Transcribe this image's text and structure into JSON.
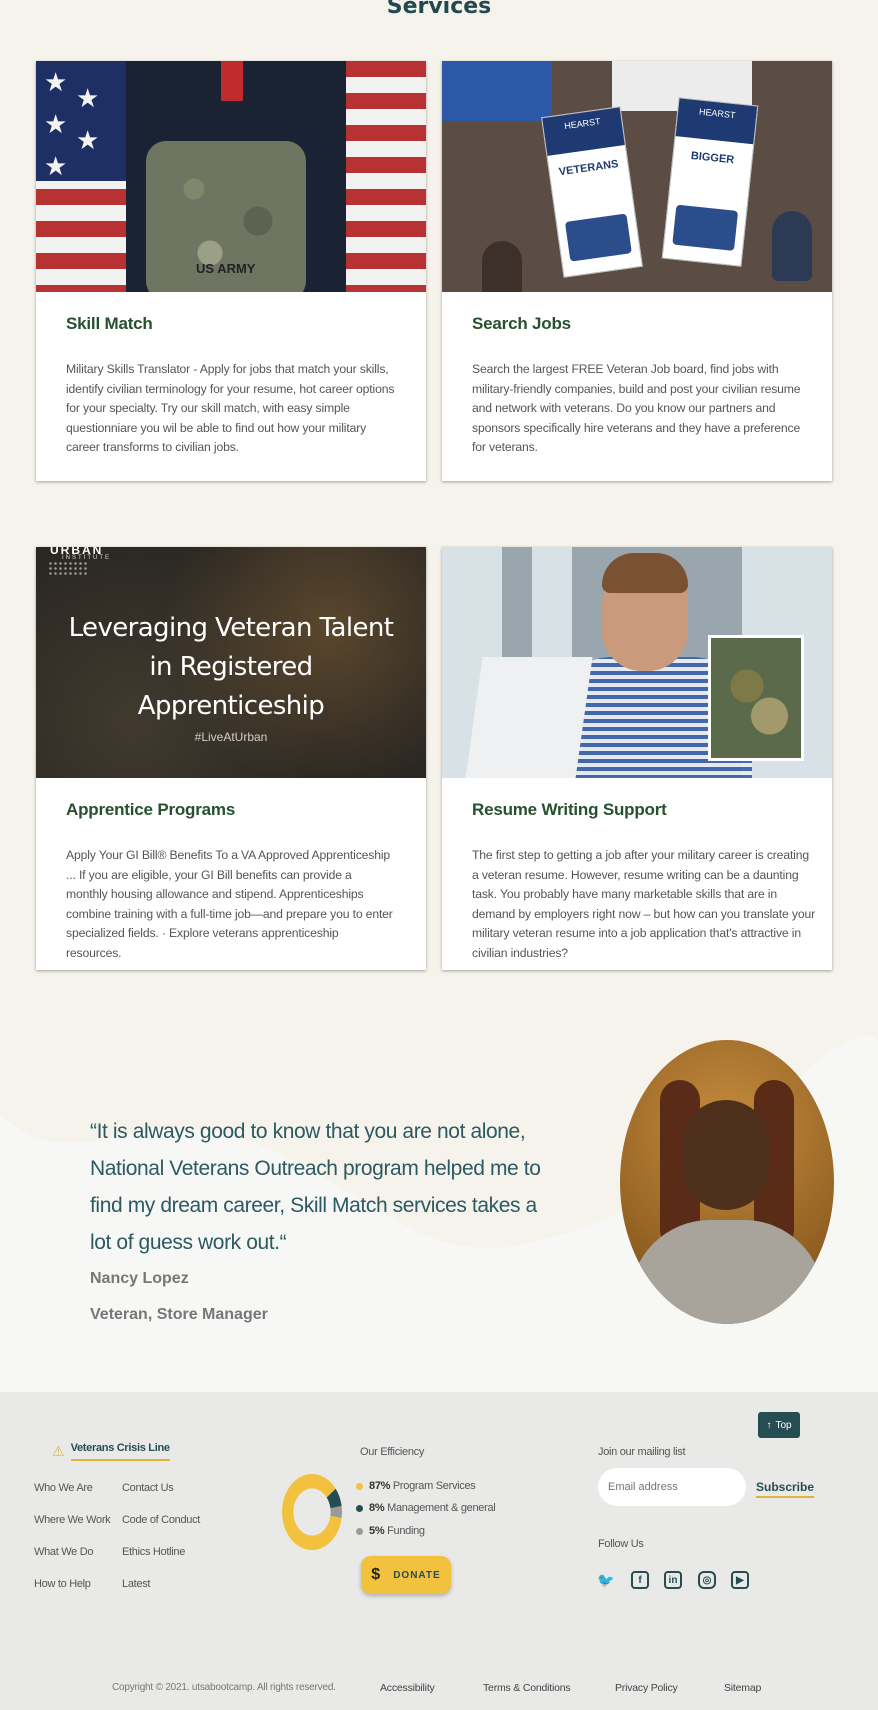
{
  "services": {
    "title": "Services",
    "cards": [
      {
        "title": "Skill Match",
        "text": "Military Skills Translator - Apply for jobs that match your skills, identify civilian terminology for your resume, hot career options for your specialty. Try our skill match, with easy simple questionniare you wil be able to find out  how your military career transforms to civilian jobs."
      },
      {
        "title": "Search Jobs",
        "text": "Search the largest FREE Veteran Job board, find jobs with military-friendly companies, build and post your civilian resume and network with veterans. Do you know our partners and sponsors specifically hire veterans and they have a preference for veterans."
      },
      {
        "title": "Apprentice Programs",
        "text": "Apply Your GI Bill® Benefits To a VA Approved Apprenticeship ... If you are eligible, your GI Bill benefits can provide a monthly housing allowance and stipend. Apprenticeships combine training with a full-time job—and prepare you to enter specialized fields. · Explore veterans apprenticeship resources."
      },
      {
        "title": "Resume Writing Support",
        "text": "The first step to getting a job after your military career is creating a veteran resume. However, resume writing can be a daunting task. You probably have many marketable skills that are in demand by employers right now – but how can you translate your military veteran resume into a job application that's attractive in civilian industries?"
      }
    ],
    "images": {
      "uniform_label": "US ARMY",
      "fair_banner_1_head": "HEARST",
      "fair_banner_1_word": "VETERANS",
      "fair_banner_2_head": "HEARST",
      "fair_banner_2_word": "BIGGER",
      "urban_logo": "URBAN",
      "urban_sub": "INSTITUTE",
      "urban_title": "Leveraging Veteran Talent in Registered Apprenticeship",
      "urban_tag": "#LiveAtUrban"
    }
  },
  "testimonial": {
    "quote": "“It is always good to know that you are not alone, National Veterans Outreach program helped me to find my dream career, Skill Match services takes a lot of guess work out.“",
    "name": "Nancy Lopez",
    "role": "Veteran, Store Manager"
  },
  "footer": {
    "top_button": "Top",
    "crisis_line": "Veterans Crisis Line",
    "nav_col1": [
      "Who We Are",
      "Where We Work",
      "What We Do",
      "How to Help"
    ],
    "nav_col2": [
      "Contact Us",
      "Code of Conduct",
      "Ethics Hotline",
      "Latest"
    ],
    "efficiency": {
      "title": "Our Efficiency",
      "items": [
        {
          "percent": "87%",
          "label": "Program Services",
          "value": 87,
          "color": "#f2c23e"
        },
        {
          "percent": "8%",
          "label": "Management & general",
          "value": 8,
          "color": "#264e52"
        },
        {
          "percent": "5%",
          "label": "Funding",
          "value": 5,
          "color": "#9a9a9a"
        }
      ]
    },
    "donate_label": "DONATE",
    "mailing": {
      "title": "Join our mailing list",
      "placeholder": "Email address",
      "subscribe": "Subscribe"
    },
    "follow_title": "Follow Us",
    "social_icons": [
      "twitter-icon",
      "facebook-icon",
      "linkedin-icon",
      "instagram-icon",
      "youtube-icon"
    ],
    "copyright": "Copyright © 2021. utsabootcamp. All rights reserved.",
    "links": [
      "Accessibility",
      "Terms & Conditions",
      "Privacy Policy",
      "Sitemap"
    ]
  },
  "colors": {
    "brand_dark": "#264e52",
    "accent_yellow": "#f2c23e",
    "heading_green": "#27502f",
    "page_bg": "#f6f3ec"
  }
}
